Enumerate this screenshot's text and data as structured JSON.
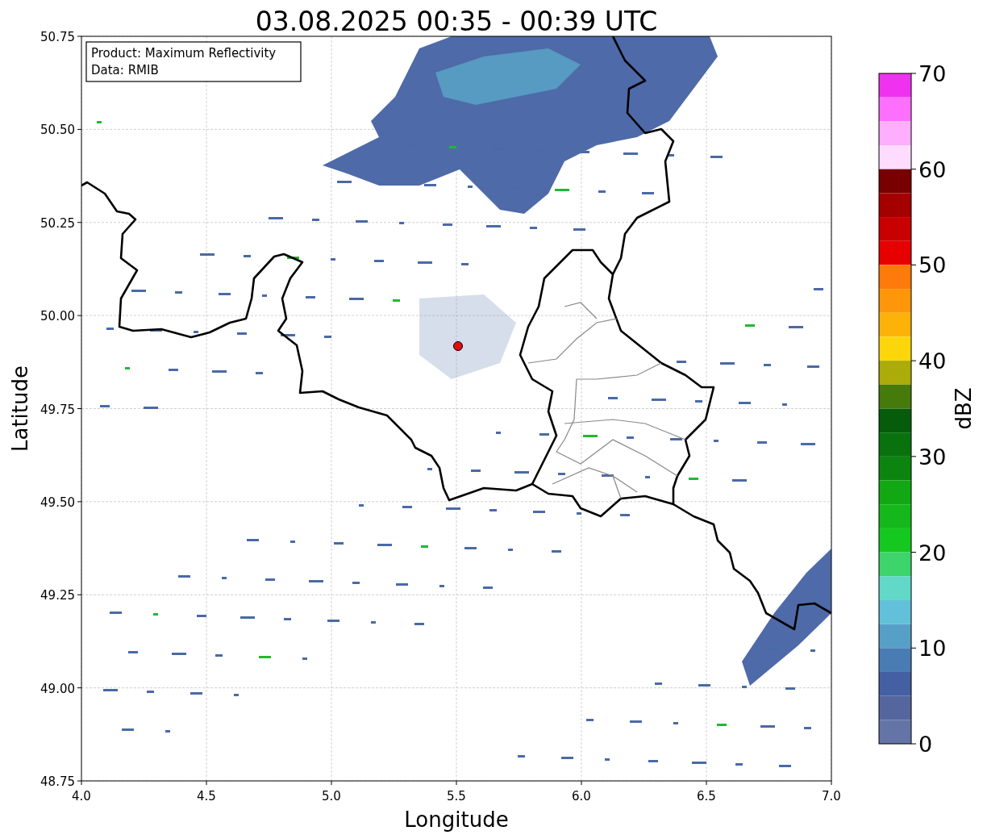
{
  "title": "03.08.2025 00:35 - 00:39 UTC",
  "legend": [
    "Product: Maximum Reflectivity",
    "Data: RMIB"
  ],
  "x_axis": {
    "label": "Longitude",
    "ticks": [
      "4.0",
      "4.5",
      "5.0",
      "5.5",
      "6.0",
      "6.5",
      "7.0"
    ]
  },
  "y_axis": {
    "label": "Latitude",
    "ticks": [
      "50.75",
      "50.50",
      "50.25",
      "50.00",
      "49.75",
      "49.50",
      "49.25",
      "49.00",
      "48.75"
    ]
  },
  "colorbar": {
    "label": "dBZ",
    "ticks": [
      "70",
      "60",
      "50",
      "40",
      "30",
      "20",
      "10",
      "0"
    ],
    "segments": [
      {
        "color": "#f032f0"
      },
      {
        "color": "#fd70fd"
      },
      {
        "color": "#fdaefd"
      },
      {
        "color": "#fedcfe"
      },
      {
        "color": "#780000"
      },
      {
        "color": "#a50000"
      },
      {
        "color": "#c80000"
      },
      {
        "color": "#e60000"
      },
      {
        "color": "#fe7a0a"
      },
      {
        "color": "#fe960a"
      },
      {
        "color": "#fdb20a"
      },
      {
        "color": "#fcd60a"
      },
      {
        "color": "#abab0a"
      },
      {
        "color": "#467a0a"
      },
      {
        "color": "#065c0b"
      },
      {
        "color": "#09720e"
      },
      {
        "color": "#0b8510"
      },
      {
        "color": "#12a814"
      },
      {
        "color": "#14b81a"
      },
      {
        "color": "#15c820"
      },
      {
        "color": "#3dd46b"
      },
      {
        "color": "#61d8c8"
      },
      {
        "color": "#63c0da"
      },
      {
        "color": "#56a0c8"
      },
      {
        "color": "#4a7cb4"
      },
      {
        "color": "#4560a2"
      },
      {
        "color": "#55669f"
      },
      {
        "color": "#6474a6"
      }
    ]
  }
}
